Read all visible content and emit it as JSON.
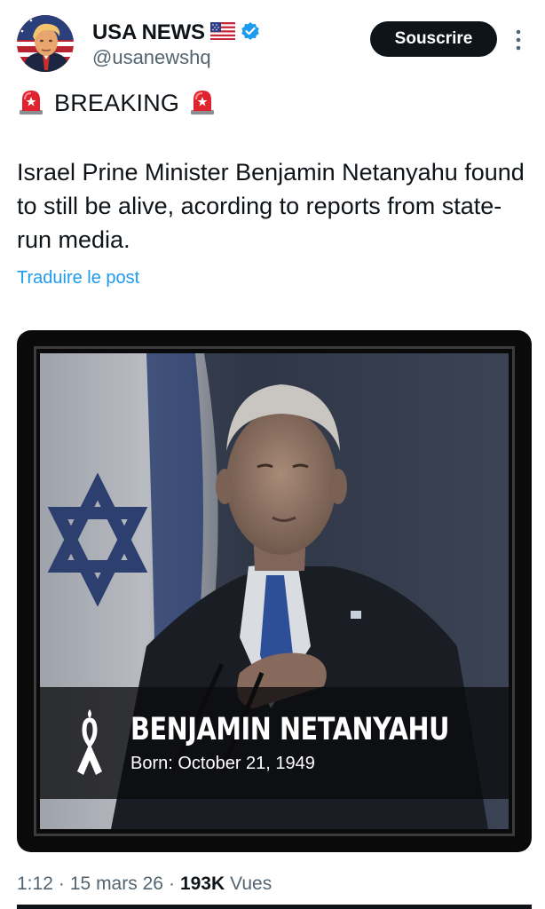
{
  "author": {
    "name": "USA NEWS",
    "handle": "@usanewshq",
    "flag_icon": "us-flag-icon",
    "verified_icon": "verified-badge-icon"
  },
  "header": {
    "subscribe_label": "Souscrire",
    "more_icon": "more-vertical-icon"
  },
  "tweet": {
    "breaking_label": "BREAKING",
    "breaking_icon": "rotating-light-icon",
    "text": "Israel Prine Minister Benjamin Netanyahu found to still be alive, acording to reports from state-run media.",
    "translate_label": "Traduire le post"
  },
  "media": {
    "caption_name": "BENJAMIN NETANYAHU",
    "caption_born": "Born: October 21, 1949",
    "ribbon_icon": "awareness-ribbon-icon"
  },
  "meta": {
    "time": "1:12",
    "separator": "·",
    "date": "15 mars 26",
    "views_count": "193K",
    "views_label": "Vues"
  },
  "colors": {
    "link": "#1d9bf0",
    "verified": "#1d9bf0",
    "text_primary": "#0f1419",
    "text_secondary": "#536471",
    "button_bg": "#0f1419"
  }
}
